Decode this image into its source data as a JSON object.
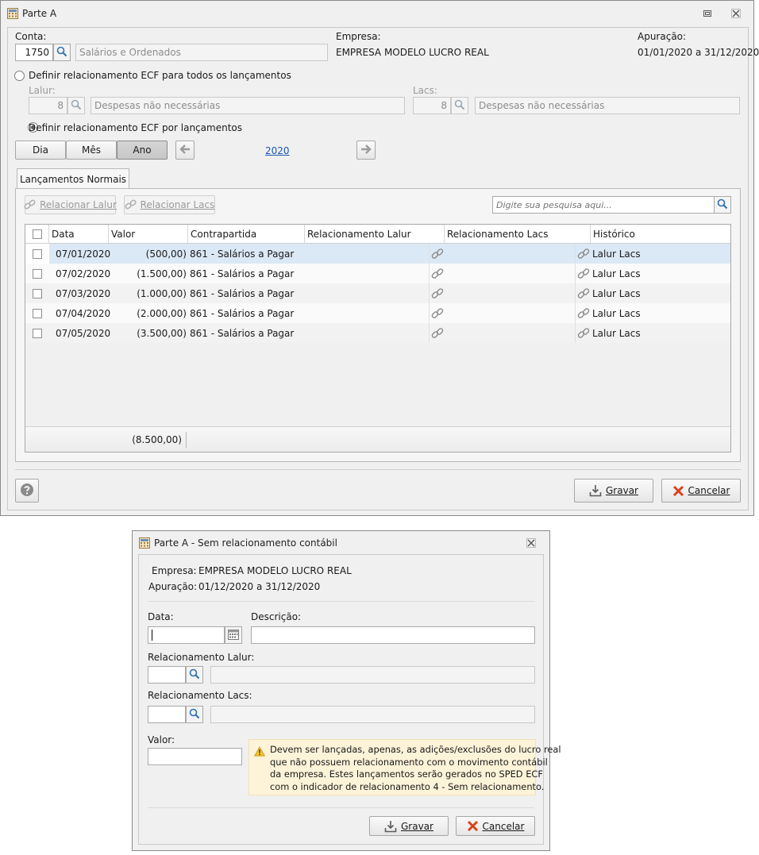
{
  "main_window": {
    "title": "Parte A",
    "conta_label": "Conta:",
    "conta_code": "1750",
    "conta_desc": "Salários e Ordenados",
    "empresa_label": "Empresa:",
    "empresa_value": "EMPRESA MODELO LUCRO REAL",
    "apuracao_label": "Apuração:",
    "apuracao_value": "01/01/2020 a 31/12/2020",
    "radio_all_label": "Definir relacionamento ECF para todos os lançamentos",
    "lalur_label": "Lalur:",
    "lalur_code": "8",
    "lalur_desc": "Despesas não necessárias",
    "lacs_label": "Lacs:",
    "lacs_code": "8",
    "lacs_desc": "Despesas não necessárias",
    "radio_per_label": "Definir relacionamento ECF por lançamentos",
    "period_buttons": [
      "Dia",
      "Mês",
      "Ano"
    ],
    "selected_period": "Ano",
    "year": "2020",
    "tab_label": "Lançamentos Normais",
    "btn_relacionar_lalur": "Relacionar Lalur",
    "btn_relacionar_lacs": "Relacionar Lacs",
    "search_placeholder": "Digite sua pesquisa aqui...",
    "columns": [
      "Data",
      "Valor",
      "Contrapartida",
      "Relacionamento Lalur",
      "Relacionamento Lacs",
      "Histórico"
    ],
    "rows": [
      {
        "data": "07/01/2020",
        "valor": "(500,00)",
        "contrapartida": "861 - Salários a Pagar",
        "historico": "Lalur Lacs"
      },
      {
        "data": "07/02/2020",
        "valor": "(1.500,00)",
        "contrapartida": "861 - Salários a Pagar",
        "historico": "Lalur Lacs"
      },
      {
        "data": "07/03/2020",
        "valor": "(1.000,00)",
        "contrapartida": "861 - Salários a Pagar",
        "historico": "Lalur Lacs"
      },
      {
        "data": "07/04/2020",
        "valor": "(2.000,00)",
        "contrapartida": "861 - Salários a Pagar",
        "historico": "Lalur Lacs"
      },
      {
        "data": "07/05/2020",
        "valor": "(3.500,00)",
        "contrapartida": "861 - Salários a Pagar",
        "historico": "Lalur Lacs"
      }
    ],
    "total": "(8.500,00)",
    "btn_gravar": "Gravar",
    "btn_cancelar": "Cancelar"
  },
  "dialog": {
    "title": "Parte A - Sem relacionamento contábil",
    "empresa_label": "Empresa:",
    "empresa_value": "EMPRESA MODELO LUCRO REAL",
    "apuracao_label": "Apuração:",
    "apuracao_value": "01/12/2020 a 31/12/2020",
    "data_label": "Data:",
    "descricao_label": "Descrição:",
    "rel_lalur_label": "Relacionamento Lalur:",
    "rel_lacs_label": "Relacionamento Lacs:",
    "valor_label": "Valor:",
    "warning_lines": [
      "Devem ser lançadas, apenas, as adições/exclusões do lucro real",
      "que não possuem relacionamento com o movimento contábil",
      "da empresa. Estes lançamentos serão gerados no SPED ECF",
      "com o indicador de relacionamento 4 - Sem relacionamento."
    ],
    "btn_gravar": "Gravar",
    "btn_cancelar": "Cancelar"
  },
  "colors": {
    "selected_row": "#dbe8f5",
    "alt_row": "#f2f2f2",
    "link": "#1a55b5",
    "cancel_x": "#d9421b",
    "warning": "#e6a817"
  }
}
